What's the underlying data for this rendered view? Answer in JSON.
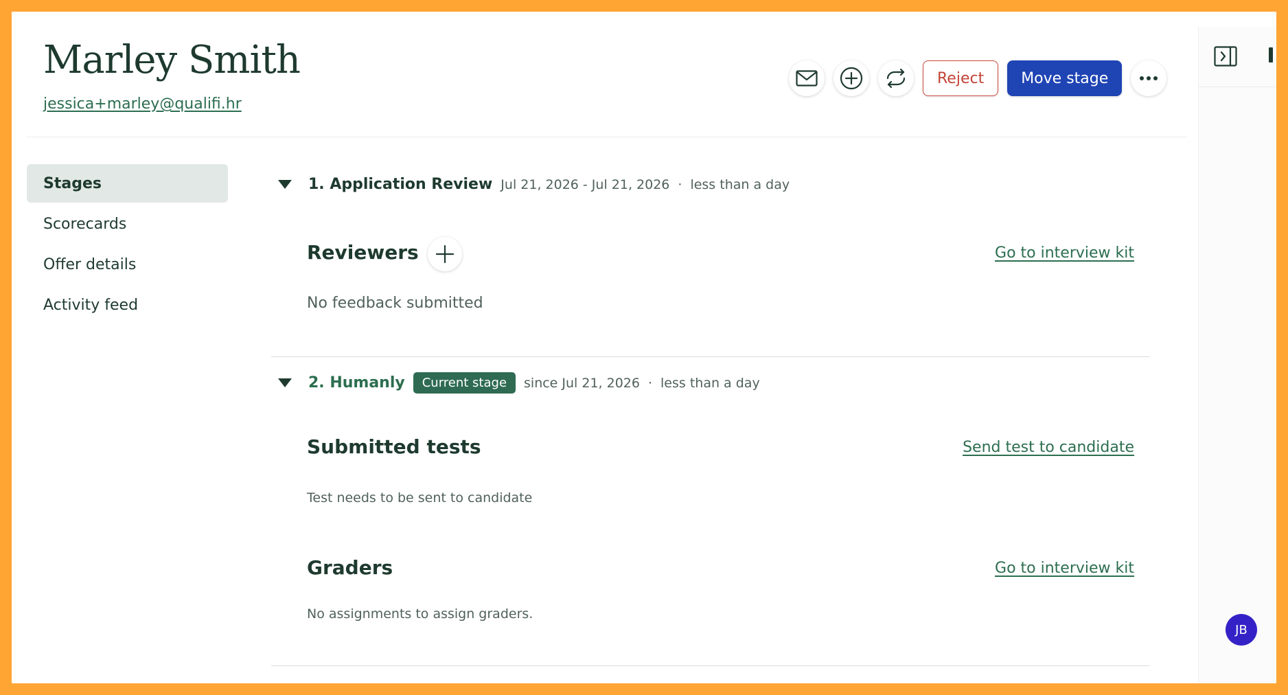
{
  "candidate": {
    "name": "Marley Smith",
    "email": "jessica+marley@qualifi.hr"
  },
  "actions": {
    "email_icon": "mail-icon",
    "add_icon": "plus-circle-icon",
    "refresh_icon": "refresh-icon",
    "reject_label": "Reject",
    "move_stage_label": "Move stage",
    "more_icon": "more-horizontal-icon"
  },
  "nav": {
    "items": [
      {
        "label": "Stages",
        "active": true
      },
      {
        "label": "Scorecards",
        "active": false
      },
      {
        "label": "Offer details",
        "active": false
      },
      {
        "label": "Activity feed",
        "active": false
      }
    ]
  },
  "stages": [
    {
      "title": "1. Application Review",
      "dates": "Jul 21, 2026 - Jul 21, 2026",
      "separator": "·",
      "duration": "less than a day",
      "reviewers_title": "Reviewers",
      "interview_kit_link": "Go to interview kit",
      "feedback_text": "No feedback submitted"
    },
    {
      "title": "2. Humanly",
      "badge": "Current stage",
      "dates": "since Jul 21, 2026",
      "separator": "·",
      "duration": "less than a day",
      "tests_title": "Submitted tests",
      "send_test_link": "Send test to candidate",
      "tests_text": "Test needs to be sent to candidate",
      "graders_title": "Graders",
      "graders_link": "Go to interview kit",
      "graders_text": "No assignments to assign graders."
    }
  ],
  "avatar": {
    "initials": "JB",
    "color": "#3522c7"
  },
  "colors": {
    "frame": "#ffa534",
    "primary": "#1f44b4",
    "reject": "#c24336",
    "green": "#2c6e4f"
  }
}
